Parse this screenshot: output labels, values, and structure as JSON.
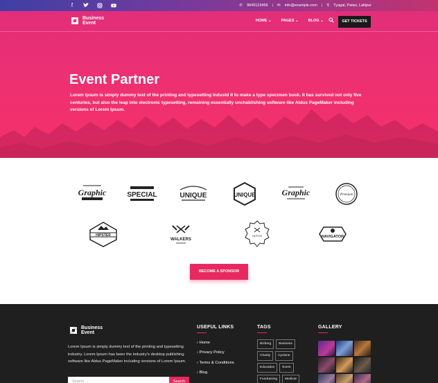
{
  "topbar": {
    "social": [
      "facebook-icon",
      "twitter-icon",
      "instagram-icon",
      "youtube-icon"
    ],
    "phone": "9849123456",
    "email": "info@example.com",
    "location": "Tyagal, Patan, Lalitpur"
  },
  "brand": {
    "line1": "Business",
    "line2": "Event"
  },
  "nav": {
    "home": "HOME",
    "pages": "PAGES",
    "blog": "BLOG",
    "tickets": "GET TICKETS"
  },
  "hero": {
    "title": "Event Partner",
    "text": "Lorem Ipsum is simply dummy text of the printing and typesetting industd it to make a type specimen book. It has survived not only five centuries, but also the leap into electronic typesetting, remaining essentially unchablishing software like Aldus PageMaker including versions of Lorem Ipsum."
  },
  "partners": {
    "cta": "BECOME A SPONSOR",
    "logos": [
      "Graphic",
      "SPECIAL",
      "UNIQUE",
      "UNIQUE",
      "Graphic",
      "Premium",
      "HIPSTER",
      "WALKERS",
      "HUTCH",
      "NAVIGATOR"
    ]
  },
  "footer": {
    "about": "Lorem Ipsum is simply dummy text of the printing and typesetting industry. Lorem Ipsum has been the industry's desktop publishing software like Aldus PageMaker including versions of Lorem Ipsum.",
    "search_placeholder": "Search ...",
    "search_button": "Search",
    "useful_links_title": "USEFUL LINKS",
    "links": [
      "Home",
      "Privacy Policy",
      "Terms & Conditions",
      "Blog"
    ],
    "tags_title": "TAGS",
    "tags": [
      "Bizberg",
      "Business",
      "Charity",
      "Cyclone",
      "Education",
      "Event",
      "Fundraising",
      "Medical"
    ],
    "gallery_title": "GALLERY"
  },
  "colors": {
    "accent": "#e8295f",
    "hero": "#f0306f",
    "footer": "#1f1f1f"
  }
}
